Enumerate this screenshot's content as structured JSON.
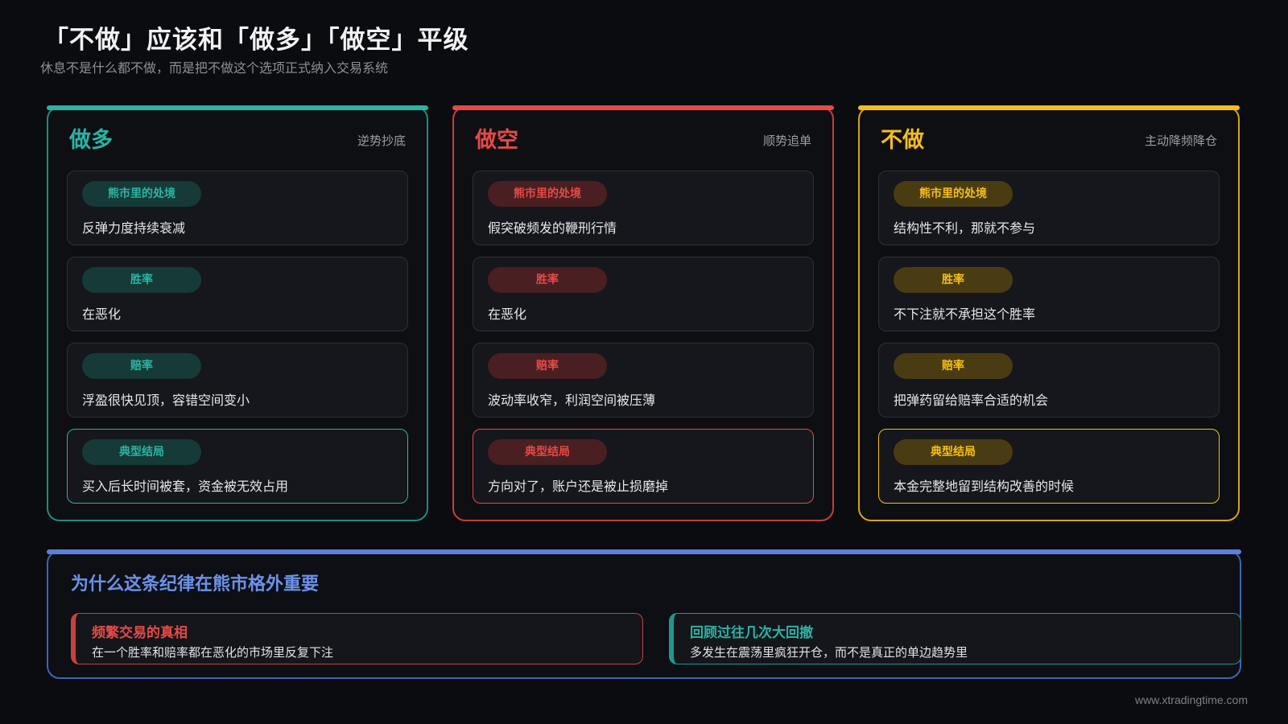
{
  "header": {
    "title": "「不做」应该和「做多」「做空」平级",
    "subtitle": "休息不是什么都不做，而是把不做这个选项正式纳入交易系统"
  },
  "columns": [
    {
      "title": "做多",
      "tag": "逆势抄底",
      "accent": "#2bb3a3",
      "cards": [
        {
          "label": "熊市里的处境",
          "text": "反弹力度持续衰减"
        },
        {
          "label": "胜率",
          "text": "在恶化"
        },
        {
          "label": "赔率",
          "text": "浮盈很快见顶，容错空间变小"
        },
        {
          "label": "典型结局",
          "text": "买入后长时间被套，资金被无效占用"
        }
      ]
    },
    {
      "title": "做空",
      "tag": "顺势追单",
      "accent": "#e44a47",
      "cards": [
        {
          "label": "熊市里的处境",
          "text": "假突破频发的鞭刑行情"
        },
        {
          "label": "胜率",
          "text": "在恶化"
        },
        {
          "label": "赔率",
          "text": "波动率收窄，利润空间被压薄"
        },
        {
          "label": "典型结局",
          "text": "方向对了，账户还是被止损磨掉"
        }
      ]
    },
    {
      "title": "不做",
      "tag": "主动降频降仓",
      "accent": "#f5be1c",
      "cards": [
        {
          "label": "熊市里的处境",
          "text": "结构性不利，那就不参与"
        },
        {
          "label": "胜率",
          "text": "不下注就不承担这个胜率"
        },
        {
          "label": "赔率",
          "text": "把弹药留给赔率合适的机会"
        },
        {
          "label": "典型结局",
          "text": "本金完整地留到结构改善的时候"
        }
      ]
    }
  ],
  "bottom": {
    "title": "为什么这条纪律在熊市格外重要",
    "accent": "#5b7fdb",
    "items": [
      {
        "title": "频繁交易的真相",
        "text": "在一个胜率和赔率都在恶化的市场里反复下注"
      },
      {
        "title": "回顾过往几次大回撤",
        "text": "多发生在震荡里疯狂开仓，而不是真正的单边趋势里"
      }
    ]
  },
  "footer": {
    "url": "www.xtradingtime.com"
  }
}
